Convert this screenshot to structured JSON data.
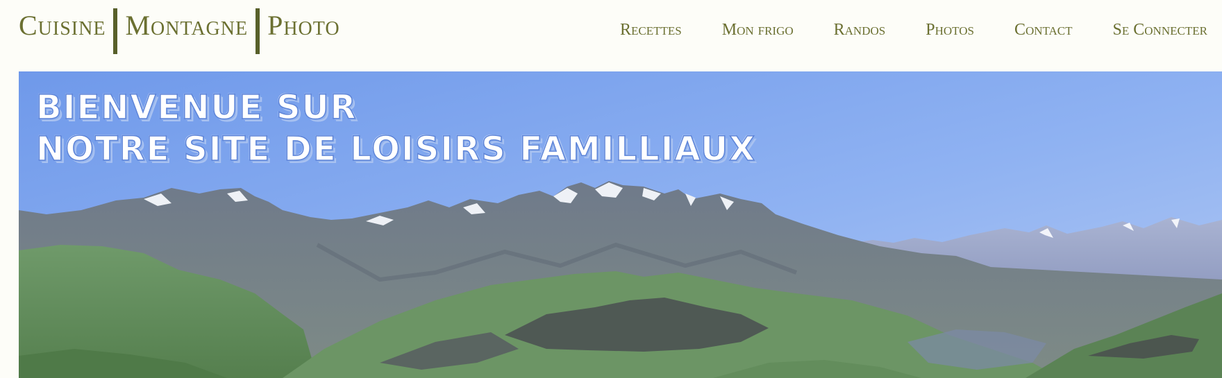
{
  "brand": {
    "part1": "Cuisine",
    "part2": "Montagne",
    "part3": "Photo"
  },
  "nav": {
    "items": [
      {
        "label": "Recettes"
      },
      {
        "label": "Mon frigo"
      },
      {
        "label": "Randos"
      },
      {
        "label": "Photos"
      },
      {
        "label": "Contact"
      },
      {
        "label": "Se Connecter"
      }
    ]
  },
  "hero": {
    "line1": "Bienvenue sur",
    "line2": "notre site de loisirs familliaux"
  },
  "colors": {
    "brand_text": "#6b7031",
    "brand_divider": "#58602a",
    "page_background": "#fdfdf8",
    "sky": "#7ea3ea"
  }
}
